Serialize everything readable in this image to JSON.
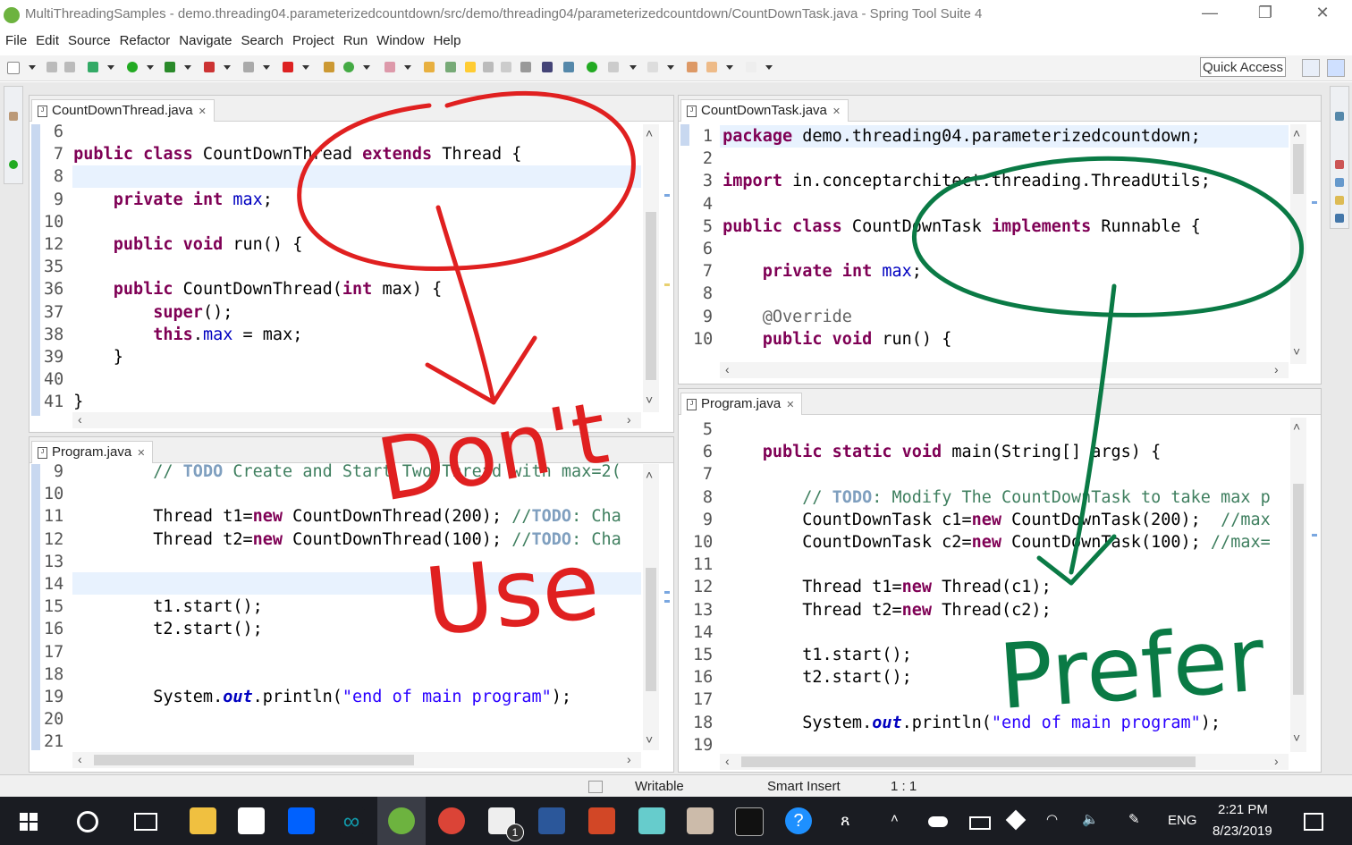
{
  "window": {
    "title": "MultiThreadingSamples - demo.threading04.parameterizedcountdown/src/demo/threading04/parameterizedcountdown/CountDownTask.java - Spring Tool Suite 4",
    "minimize": "—",
    "restore": "❐",
    "close": "✕"
  },
  "menu": [
    "File",
    "Edit",
    "Source",
    "Refactor",
    "Navigate",
    "Search",
    "Project",
    "Run",
    "Window",
    "Help"
  ],
  "toolbar": {
    "quick_access": "Quick Access"
  },
  "editors": {
    "top_left": {
      "tab": "CountDownThread.java",
      "lines": [
        {
          "n": "6",
          "c": ""
        },
        {
          "n": "7",
          "c": "<span class='kw'>public class</span> CountDownThread <span class='kw'>extends</span> Thread {"
        },
        {
          "n": "8",
          "c": ""
        },
        {
          "n": "9",
          "c": "    <span class='kw'>private int</span> <span class='fld'>max</span>;"
        },
        {
          "n": "10",
          "c": ""
        },
        {
          "n": "12",
          "c": "    <span class='kw'>public void</span> run() {"
        },
        {
          "n": "35",
          "c": ""
        },
        {
          "n": "36",
          "c": "    <span class='kw'>public</span> CountDownThread(<span class='kw'>int</span> max) {"
        },
        {
          "n": "37",
          "c": "        <span class='kw'>super</span>();"
        },
        {
          "n": "38",
          "c": "        <span class='kw'>this</span>.<span class='fld'>max</span> = max;"
        },
        {
          "n": "39",
          "c": "    }"
        },
        {
          "n": "40",
          "c": ""
        },
        {
          "n": "41",
          "c": "}"
        }
      ]
    },
    "bottom_left": {
      "tab": "Program.java",
      "lines": [
        {
          "n": "9",
          "c": "        <span class='cmt'>// </span><span class='todo'>TODO</span><span class='cmt'> Create and Start Two Thread with max=2(</span>"
        },
        {
          "n": "10",
          "c": ""
        },
        {
          "n": "11",
          "c": "        Thread t1=<span class='kw'>new</span> CountDownThread(200); <span class='cmt'>//</span><span class='todo'>TODO</span><span class='cmt'>: Cha</span>"
        },
        {
          "n": "12",
          "c": "        Thread t2=<span class='kw'>new</span> CountDownThread(100); <span class='cmt'>//</span><span class='todo'>TODO</span><span class='cmt'>: Cha</span>"
        },
        {
          "n": "13",
          "c": ""
        },
        {
          "n": "14",
          "c": ""
        },
        {
          "n": "15",
          "c": "        t1.start();"
        },
        {
          "n": "16",
          "c": "        t2.start();"
        },
        {
          "n": "17",
          "c": ""
        },
        {
          "n": "18",
          "c": ""
        },
        {
          "n": "19",
          "c": "        System.<span class='sfld'>out</span>.println(<span class='str'>\"end of main program\"</span>);"
        },
        {
          "n": "20",
          "c": ""
        },
        {
          "n": "21",
          "c": ""
        }
      ]
    },
    "top_right": {
      "tab": "CountDownTask.java",
      "lines": [
        {
          "n": "1",
          "c": "<span class='kw'>package</span> demo.threading04.parameterizedcountdown;"
        },
        {
          "n": "2",
          "c": ""
        },
        {
          "n": "3",
          "c": "<span class='kw'>import</span> in.conceptarchitect.threading.ThreadUtils;"
        },
        {
          "n": "4",
          "c": ""
        },
        {
          "n": "5",
          "c": "<span class='kw'>public class</span> CountDownTask <span class='kw'>implements</span> Runnable {"
        },
        {
          "n": "6",
          "c": ""
        },
        {
          "n": "7",
          "c": "    <span class='kw'>private int</span> <span class='fld'>max</span>;"
        },
        {
          "n": "8",
          "c": ""
        },
        {
          "n": "9",
          "c": "    <span class='ann'>@Override</span>"
        },
        {
          "n": "10",
          "c": "    <span class='kw'>public void</span> run() {"
        }
      ]
    },
    "bottom_right": {
      "tab": "Program.java",
      "lines": [
        {
          "n": "5",
          "c": ""
        },
        {
          "n": "6",
          "c": "    <span class='kw'>public static void</span> main(String[] args) {"
        },
        {
          "n": "7",
          "c": ""
        },
        {
          "n": "8",
          "c": "        <span class='cmt'>// </span><span class='todo'>TODO</span><span class='cmt'>: Modify The CountDownTask to take max p</span>"
        },
        {
          "n": "9",
          "c": "        CountDownTask c1=<span class='kw'>new</span> CountDownTask(200);  <span class='cmt'>//max</span>"
        },
        {
          "n": "10",
          "c": "        CountDownTask c2=<span class='kw'>new</span> CountDownTask(100); <span class='cmt'>//max=</span>"
        },
        {
          "n": "11",
          "c": ""
        },
        {
          "n": "12",
          "c": "        Thread t1=<span class='kw'>new</span> Thread(c1);"
        },
        {
          "n": "13",
          "c": "        Thread t2=<span class='kw'>new</span> Thread(c2);"
        },
        {
          "n": "14",
          "c": ""
        },
        {
          "n": "15",
          "c": "        t1.start();"
        },
        {
          "n": "16",
          "c": "        t2.start();"
        },
        {
          "n": "17",
          "c": ""
        },
        {
          "n": "18",
          "c": "        System.<span class='sfld'>out</span>.println(<span class='str'>\"end of main program\"</span>);"
        },
        {
          "n": "19",
          "c": ""
        }
      ]
    }
  },
  "annotations": {
    "red_words": [
      "Don't",
      "Use"
    ],
    "green_word": "Prefer",
    "red_color": "#e02020",
    "green_color": "#0a7a45"
  },
  "status": {
    "writable": "Writable",
    "insert_mode": "Smart Insert",
    "position": "1 : 1"
  },
  "taskbar": {
    "language": "ENG",
    "time": "2:21 PM",
    "date": "8/23/2019",
    "mail_badge": "1"
  }
}
